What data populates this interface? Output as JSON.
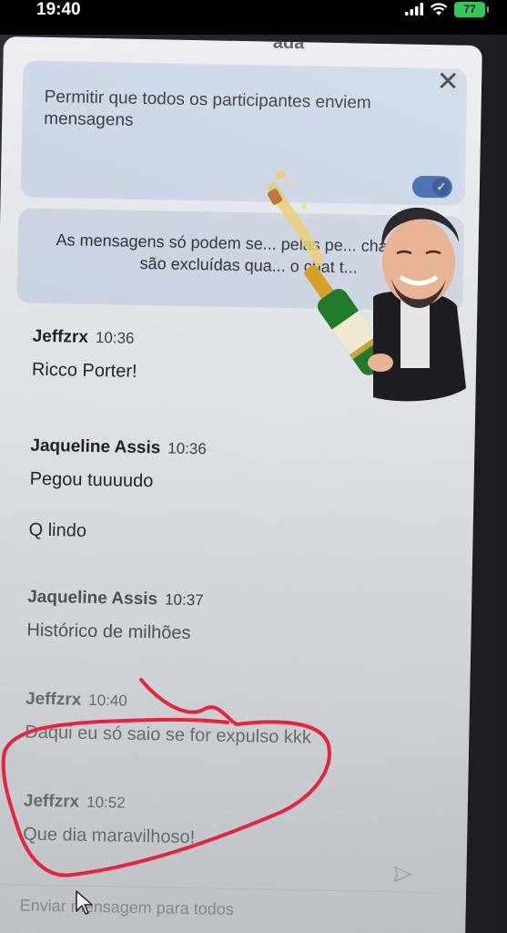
{
  "status_bar": {
    "time": "19:40",
    "battery": "77",
    "icons": [
      "signal-icon",
      "wifi-icon",
      "battery-icon"
    ]
  },
  "panel": {
    "title_fragment": "ada",
    "permission_label": "Permitir que todos os participantes enviem mensagens",
    "toggle_on": true,
    "info_text": "As mensagens só podem se... pelas pe... chamada e são excluídas qua... o chat t..."
  },
  "messages": [
    {
      "sender": "Jeffzrx",
      "time": "10:36",
      "text": "Ricco Porter!"
    },
    {
      "sender": "Jaqueline Assis",
      "time": "10:36",
      "text": "Pegou tuuuudo",
      "extra": "Q lindo"
    },
    {
      "sender": "Jaqueline Assis",
      "time": "10:37",
      "text": "Histórico de milhões"
    },
    {
      "sender": "Jeffzrx",
      "time": "10:40",
      "text": "Daqui eu só saio se for expulso kkk"
    },
    {
      "sender": "Jeffzrx",
      "time": "10:52",
      "text": "Que dia maravilhoso!"
    }
  ],
  "composer": {
    "placeholder": "Enviar mensagem para todos"
  },
  "colors": {
    "toggle_on": "#2f5aa8",
    "card_bg": "#c8d3e4",
    "annotation_red": "#e8233a"
  }
}
